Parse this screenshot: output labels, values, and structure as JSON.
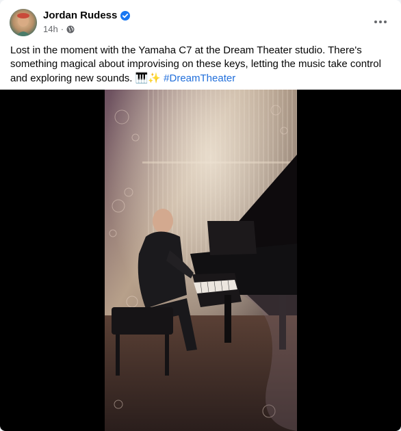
{
  "post": {
    "author": "Jordan Rudess",
    "timestamp": "14h",
    "separator": "·",
    "visibility_icon": "globe-icon",
    "verified_icon": "verified-badge-icon",
    "more_icon": "more-options-icon",
    "caption_text": "Lost in the moment with the Yamaha C7 at the Dream Theater studio. There's something magical about improvising on these keys, letting the music take control and exploring new sounds.",
    "caption_emojis": "🎹✨",
    "hashtag": "#DreamTheater"
  },
  "colors": {
    "accent": "#216fdb",
    "verified": "#1877f2",
    "meta_text": "#65676b",
    "media_background": "#000000"
  }
}
